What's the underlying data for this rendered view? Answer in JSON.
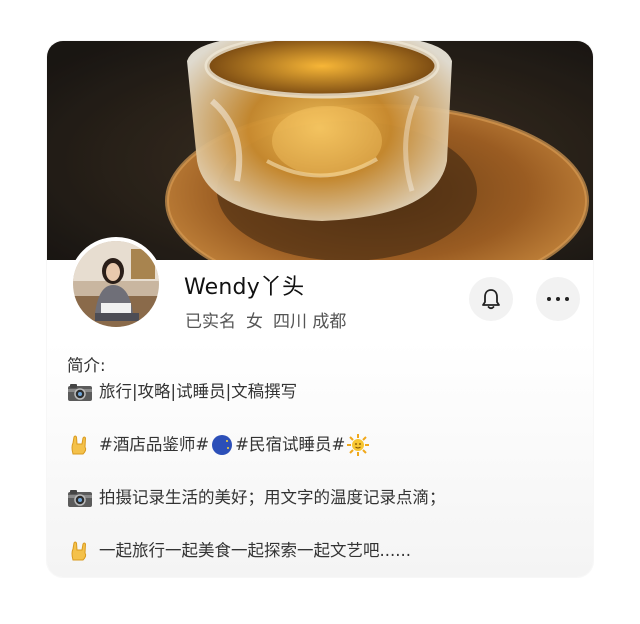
{
  "profile": {
    "name": "Wendy丫头",
    "verified_label": "已实名",
    "gender": "女",
    "location": "四川 成都"
  },
  "bio": {
    "label": "简介:",
    "line1": "旅行|攻略|试睡员|文稿撰写",
    "line2_a": "#酒店品鉴师#",
    "line2_b": "#民宿试睡员#",
    "line3": "拍摄记录生活的美好；用文字的温度记录点滴；",
    "line4": "一起旅行一起美食一起探索一起文艺吧......"
  },
  "icons": {
    "bell": "bell-icon",
    "more": "more-icon",
    "camera": "camera-emoji",
    "hand": "rock-hand-emoji",
    "moon": "moon-emoji",
    "sun": "sun-emoji"
  },
  "colors": {
    "button_bg": "#f2f2f2",
    "text_primary": "#111111",
    "text_secondary": "#555555"
  }
}
